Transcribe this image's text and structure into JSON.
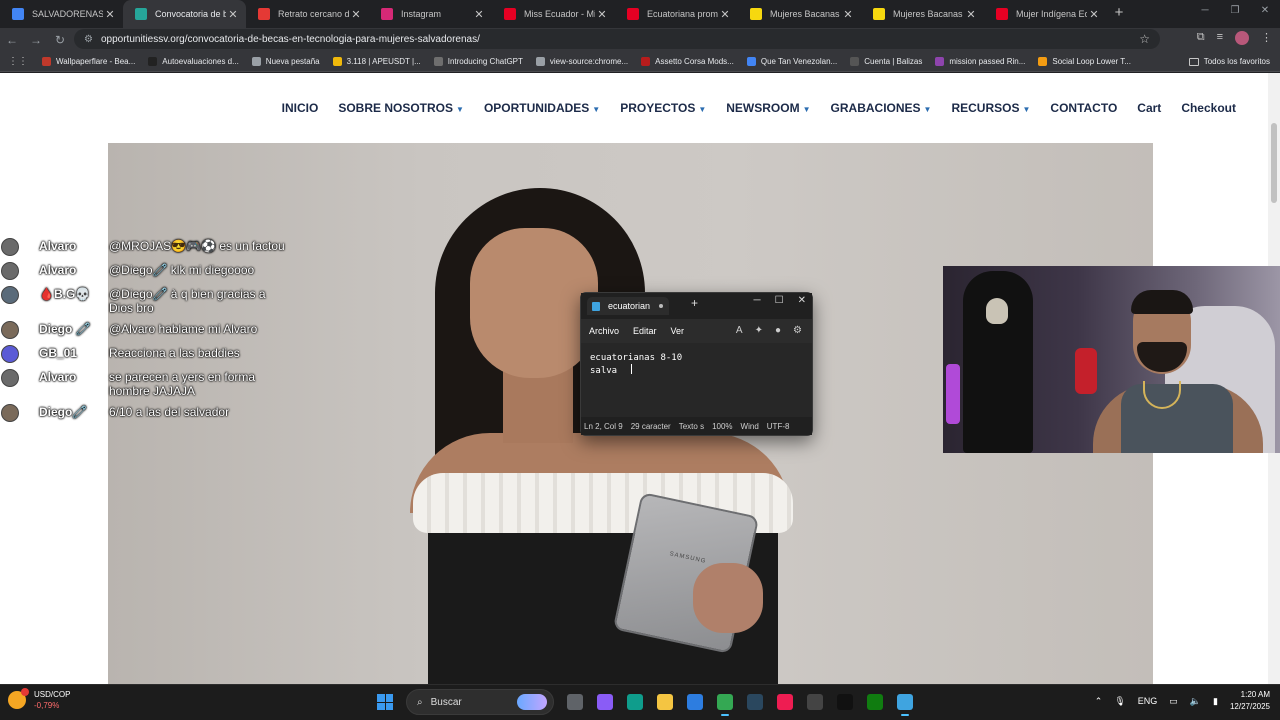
{
  "browser": {
    "tabs": [
      {
        "label": "SALVADORENAS - Bu",
        "color": "#4285f4",
        "active": false
      },
      {
        "label": "Convocatoria de bec",
        "color": "#26a69a",
        "active": true
      },
      {
        "label": "Retrato cercano de d",
        "color": "#e53935",
        "active": false
      },
      {
        "label": "Instagram",
        "color": "#d62976",
        "active": false
      },
      {
        "label": "Miss Ecuador - Miss",
        "color": "#e60023",
        "active": false
      },
      {
        "label": "Ecuatoriana promedi",
        "color": "#e60023",
        "active": false
      },
      {
        "label": "Mujeres Bacanas | El",
        "color": "#f6d80f",
        "active": false
      },
      {
        "label": "Mujeres Bacanas | H",
        "color": "#f6d80f",
        "active": false
      },
      {
        "label": "Mujer Indígena Ecua",
        "color": "#e60023",
        "active": false
      }
    ],
    "url": "opportunitiessv.org/convocatoria-de-becas-en-tecnologia-para-mujeres-salvadorenas/",
    "bookmarks": [
      {
        "label": "Wallpaperflare - Bea...",
        "color": "#c0392b"
      },
      {
        "label": "Autoevaluaciones d...",
        "color": "#222222"
      },
      {
        "label": "Nueva pestaña",
        "color": "#9aa0a6"
      },
      {
        "label": "3.118 | APEUSDT |...",
        "color": "#f0b90b"
      },
      {
        "label": "Introducing ChatGPT",
        "color": "#6e6e6e"
      },
      {
        "label": "view-source:chrome...",
        "color": "#9aa0a6"
      },
      {
        "label": "Assetto Corsa Mods...",
        "color": "#b71c1c"
      },
      {
        "label": "Que Tan Venezolan...",
        "color": "#4285f4"
      },
      {
        "label": "Cuenta | Balizas",
        "color": "#555555"
      },
      {
        "label": "mission passed Rin...",
        "color": "#8e44ad"
      },
      {
        "label": "Social Loop Lower T...",
        "color": "#f39c12"
      }
    ],
    "bookmarks_folder": "Todos los favoritos"
  },
  "site": {
    "nav": [
      {
        "label": "INICIO",
        "caret": false
      },
      {
        "label": "SOBRE NOSOTROS",
        "caret": true
      },
      {
        "label": "OPORTUNIDADES",
        "caret": true
      },
      {
        "label": "PROYECTOS",
        "caret": true
      },
      {
        "label": "NEWSROOM",
        "caret": true
      },
      {
        "label": "GRABACIONES",
        "caret": true
      },
      {
        "label": "RECURSOS",
        "caret": true
      },
      {
        "label": "CONTACTO",
        "caret": false
      },
      {
        "label": "Cart",
        "caret": false
      },
      {
        "label": "Checkout",
        "caret": false
      }
    ],
    "hero_tablet_brand": "SAMSUNG"
  },
  "chat": [
    {
      "user": "Alvaro",
      "badge": "🛡",
      "avatar": "#6a6a6a",
      "text": "@MROJAS😎🎮⚽ es un factou"
    },
    {
      "user": "Alvaro",
      "badge": "🛡",
      "avatar": "#6a6a6a",
      "text": "@Diego🧷 klk mi diegoooo"
    },
    {
      "user": "🩸B.G💀",
      "badge": "🛡",
      "avatar": "#5a6b7a",
      "text": "@Diego🧷 à q bien gracias a Dios bro"
    },
    {
      "user": "Diego 🧷",
      "badge": "▲",
      "avatar": "#7a6a5a",
      "text": "@Alvaro hablame mi Alvaro"
    },
    {
      "user": "GB_01",
      "badge": "",
      "avatar": "#5b5bd6",
      "text": "Reacciona a las baddies"
    },
    {
      "user": "Alvaro",
      "badge": "🛡",
      "avatar": "#6a6a6a",
      "text": "se parecen a yers en forma hombre JAJAJA"
    },
    {
      "user": "Diego🧷",
      "badge": "▲",
      "avatar": "#7a6a5a",
      "text": "6/10 a las del salvador"
    }
  ],
  "notepad": {
    "tab_title": "ecuatorian",
    "menu": [
      "Archivo",
      "Editar",
      "Ver"
    ],
    "lines": [
      "ecuatorianas 8-10",
      "salva"
    ],
    "status": [
      "Ln 2, Col 9",
      "29 caracter",
      "Texto s",
      "100%",
      "Wind",
      "UTF-8"
    ]
  },
  "taskbar": {
    "stock_name": "USD/COP",
    "stock_change": "-0,79%",
    "search_placeholder": "Buscar",
    "apps": [
      {
        "name": "task-view",
        "color": "#5f6368"
      },
      {
        "name": "copilot",
        "color": "#8a5cf6"
      },
      {
        "name": "edge",
        "color": "#0f9d8c"
      },
      {
        "name": "file-explorer",
        "color": "#f4c542"
      },
      {
        "name": "store",
        "color": "#2d7de0"
      },
      {
        "name": "chrome",
        "color": "#34a853"
      },
      {
        "name": "steam",
        "color": "#2a475e"
      },
      {
        "name": "tiktok",
        "color": "#ee1d52"
      },
      {
        "name": "obs",
        "color": "#444444"
      },
      {
        "name": "capcut",
        "color": "#111111"
      },
      {
        "name": "xbox",
        "color": "#107c10"
      },
      {
        "name": "notepad",
        "color": "#3fa4e0"
      }
    ],
    "language": "ENG",
    "time": "1:20 AM",
    "date": "12/27/2025"
  }
}
